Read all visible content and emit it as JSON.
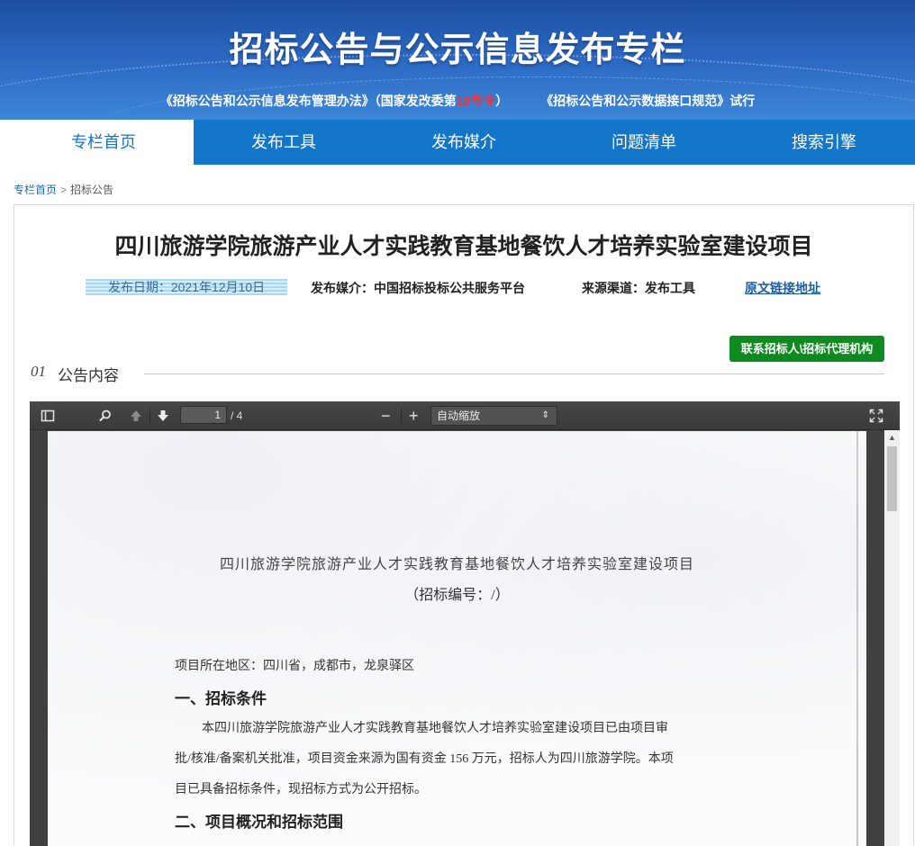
{
  "banner": {
    "title": "招标公告与公示信息发布专栏",
    "sub_part1": "《招标公告和公示信息发布管理办法》（国家发改委第",
    "sub_red": "10号令",
    "sub_part2": "）",
    "sub_part3": "《招标公告和公示数据接口规范》试行"
  },
  "nav": {
    "items": [
      {
        "label": "专栏首页"
      },
      {
        "label": "发布工具"
      },
      {
        "label": "发布媒介"
      },
      {
        "label": "问题清单"
      },
      {
        "label": "搜索引擎"
      }
    ],
    "active_index": 0
  },
  "breadcrumb": {
    "home": "专栏首页",
    "separator": ">",
    "current": "招标公告"
  },
  "notice": {
    "title": "四川旅游学院旅游产业人才实践教育基地餐饮人才培养实验室建设项目",
    "date": "发布日期：2021年12月10日",
    "media": "发布媒介：中国招标投标公共服务平台",
    "source": "来源渠道：发布工具",
    "original_link": "原文链接地址"
  },
  "contact_button": "联系招标人\\招标代理机构",
  "section": {
    "number": "01",
    "label": "公告内容"
  },
  "pdf_viewer": {
    "current_page": "1",
    "total_pages": "/ 4",
    "zoom": "自动缩放",
    "zoom_minus": "−",
    "zoom_plus": "+"
  },
  "pdf_page": {
    "title": "四川旅游学院旅游产业人才实践教育基地餐饮人才培养实验室建设项目",
    "code": "（招标编号：/）",
    "location": "项目所在地区：四川省，成都市，龙泉驿区",
    "heading1": "一、招标条件",
    "para1_line1": "本四川旅游学院旅游产业人才实践教育基地餐饮人才培养实验室建设项目已由项目审",
    "para1_line2": "批/核准/备案机关批准，项目资金来源为国有资金 156 万元，招标人为四川旅游学院。本项",
    "para1_line3": "目已具备招标条件，现招标方式为公开招标。",
    "heading2": "二、项目概况和招标范围"
  }
}
